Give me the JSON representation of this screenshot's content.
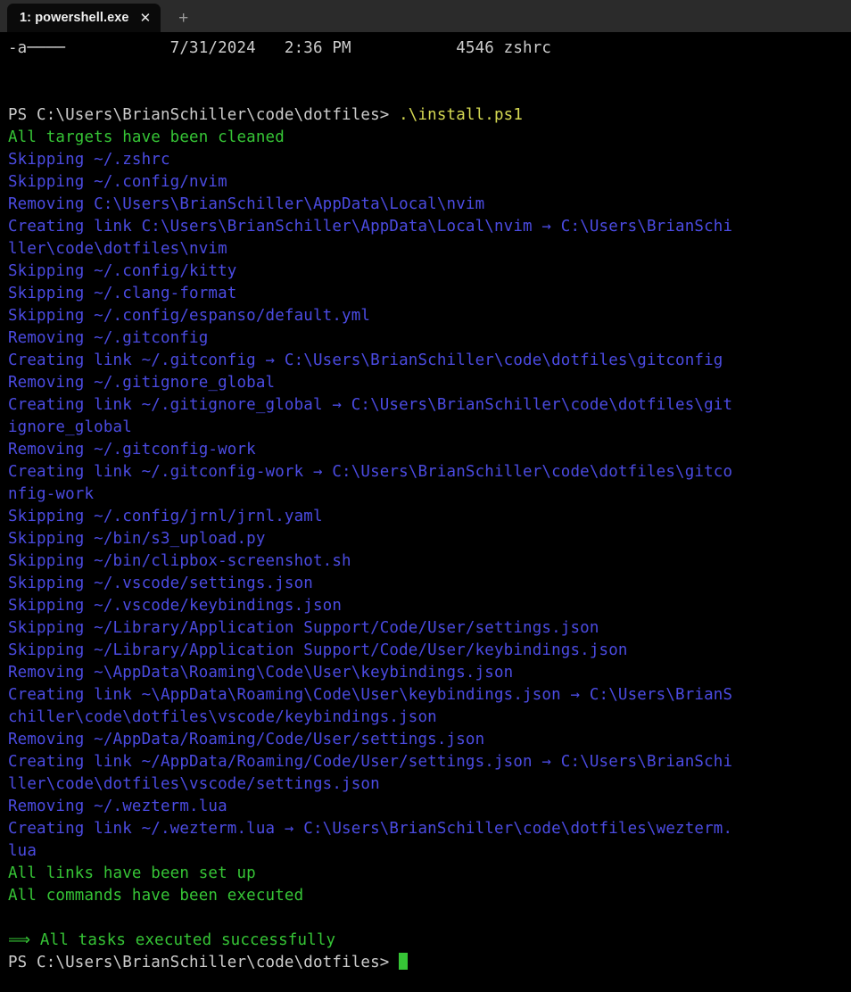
{
  "window": {
    "tab": {
      "label": "1: powershell.exe",
      "close_icon": "✕"
    },
    "new_tab_icon": "+"
  },
  "colors": {
    "background": "#000000",
    "tabbar": "#2b2b2b",
    "grey_text": "#cccccc",
    "green_text": "#36c536",
    "blue_text": "#4b4be2",
    "yellow_text": "#d6da53",
    "cursor": "#36c536"
  },
  "terminal": {
    "prompt_text": "PS C:\\Users\\BrianSchiller\\code\\dotfiles>",
    "command": ".\\install.ps1",
    "final_prompt_text": "PS C:\\Users\\BrianSchiller\\code\\dotfiles>",
    "lines": [
      {
        "id": "l0",
        "color": "grey",
        "text": "-a────           7/31/2024   2:36 PM           4546 zshrc"
      },
      {
        "id": "l1",
        "color": "none",
        "text": ""
      },
      {
        "id": "l2",
        "color": "none",
        "text": ""
      },
      {
        "id": "l3",
        "color": "green",
        "text": "All targets have been cleaned"
      },
      {
        "id": "l4",
        "color": "blue",
        "text": "Skipping ~/.zshrc"
      },
      {
        "id": "l5",
        "color": "blue",
        "text": "Skipping ~/.config/nvim"
      },
      {
        "id": "l6",
        "color": "blue",
        "text": "Removing C:\\Users\\BrianSchiller\\AppData\\Local\\nvim"
      },
      {
        "id": "l7",
        "color": "blue",
        "text": "Creating link C:\\Users\\BrianSchiller\\AppData\\Local\\nvim → C:\\Users\\BrianSchi"
      },
      {
        "id": "l8",
        "color": "blue",
        "text": "ller\\code\\dotfiles\\nvim"
      },
      {
        "id": "l9",
        "color": "blue",
        "text": "Skipping ~/.config/kitty"
      },
      {
        "id": "l10",
        "color": "blue",
        "text": "Skipping ~/.clang-format"
      },
      {
        "id": "l11",
        "color": "blue",
        "text": "Skipping ~/.config/espanso/default.yml"
      },
      {
        "id": "l12",
        "color": "blue",
        "text": "Removing ~/.gitconfig"
      },
      {
        "id": "l13",
        "color": "blue",
        "text": "Creating link ~/.gitconfig → C:\\Users\\BrianSchiller\\code\\dotfiles\\gitconfig"
      },
      {
        "id": "l14",
        "color": "blue",
        "text": "Removing ~/.gitignore_global"
      },
      {
        "id": "l15",
        "color": "blue",
        "text": "Creating link ~/.gitignore_global → C:\\Users\\BrianSchiller\\code\\dotfiles\\git"
      },
      {
        "id": "l16",
        "color": "blue",
        "text": "ignore_global"
      },
      {
        "id": "l17",
        "color": "blue",
        "text": "Removing ~/.gitconfig-work"
      },
      {
        "id": "l18",
        "color": "blue",
        "text": "Creating link ~/.gitconfig-work → C:\\Users\\BrianSchiller\\code\\dotfiles\\gitco"
      },
      {
        "id": "l19",
        "color": "blue",
        "text": "nfig-work"
      },
      {
        "id": "l20",
        "color": "blue",
        "text": "Skipping ~/.config/jrnl/jrnl.yaml"
      },
      {
        "id": "l21",
        "color": "blue",
        "text": "Skipping ~/bin/s3_upload.py"
      },
      {
        "id": "l22",
        "color": "blue",
        "text": "Skipping ~/bin/clipbox-screenshot.sh"
      },
      {
        "id": "l23",
        "color": "blue",
        "text": "Skipping ~/.vscode/settings.json"
      },
      {
        "id": "l24",
        "color": "blue",
        "text": "Skipping ~/.vscode/keybindings.json"
      },
      {
        "id": "l25",
        "color": "blue",
        "text": "Skipping ~/Library/Application Support/Code/User/settings.json"
      },
      {
        "id": "l26",
        "color": "blue",
        "text": "Skipping ~/Library/Application Support/Code/User/keybindings.json"
      },
      {
        "id": "l27",
        "color": "blue",
        "text": "Removing ~\\AppData\\Roaming\\Code\\User\\keybindings.json"
      },
      {
        "id": "l28",
        "color": "blue",
        "text": "Creating link ~\\AppData\\Roaming\\Code\\User\\keybindings.json → C:\\Users\\BrianS"
      },
      {
        "id": "l29",
        "color": "blue",
        "text": "chiller\\code\\dotfiles\\vscode/keybindings.json"
      },
      {
        "id": "l30",
        "color": "blue",
        "text": "Removing ~/AppData/Roaming/Code/User/settings.json"
      },
      {
        "id": "l31",
        "color": "blue",
        "text": "Creating link ~/AppData/Roaming/Code/User/settings.json → C:\\Users\\BrianSchi"
      },
      {
        "id": "l32",
        "color": "blue",
        "text": "ller\\code\\dotfiles\\vscode/settings.json"
      },
      {
        "id": "l33",
        "color": "blue",
        "text": "Removing ~/.wezterm.lua"
      },
      {
        "id": "l34",
        "color": "blue",
        "text": "Creating link ~/.wezterm.lua → C:\\Users\\BrianSchiller\\code\\dotfiles\\wezterm."
      },
      {
        "id": "l35",
        "color": "blue",
        "text": "lua"
      },
      {
        "id": "l36",
        "color": "green",
        "text": "All links have been set up"
      },
      {
        "id": "l37",
        "color": "green",
        "text": "All commands have been executed"
      },
      {
        "id": "l38",
        "color": "none",
        "text": ""
      },
      {
        "id": "l39",
        "color": "green",
        "text": "⟹ All tasks executed successfully"
      }
    ]
  }
}
